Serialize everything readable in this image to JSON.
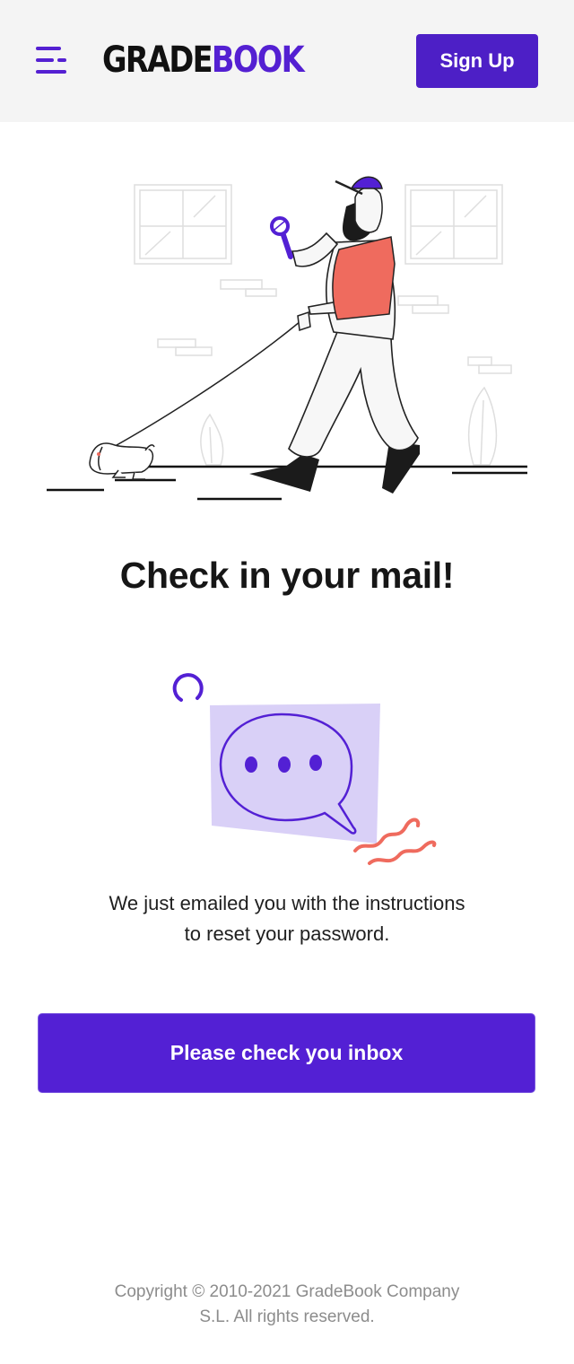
{
  "header": {
    "logo_part1": "GRADE",
    "logo_part2": "BOOK",
    "signup_label": "Sign Up",
    "menu_icon": "hamburger-menu-icon"
  },
  "main": {
    "title": "Check in your mail!",
    "message_line1": "We just emailed you with the instructions",
    "message_line2": "to reset your password.",
    "inbox_button_label": "Please check you inbox"
  },
  "footer": {
    "copyright_line1": "Copyright © 2010-2021 GradeBook Company",
    "copyright_line2": "S.L. All rights reserved."
  },
  "colors": {
    "brand_purple": "#5320d4",
    "accent_coral": "#ef6b5e",
    "bubble_bg": "#d9d0f7",
    "header_bg": "#f4f4f4"
  }
}
